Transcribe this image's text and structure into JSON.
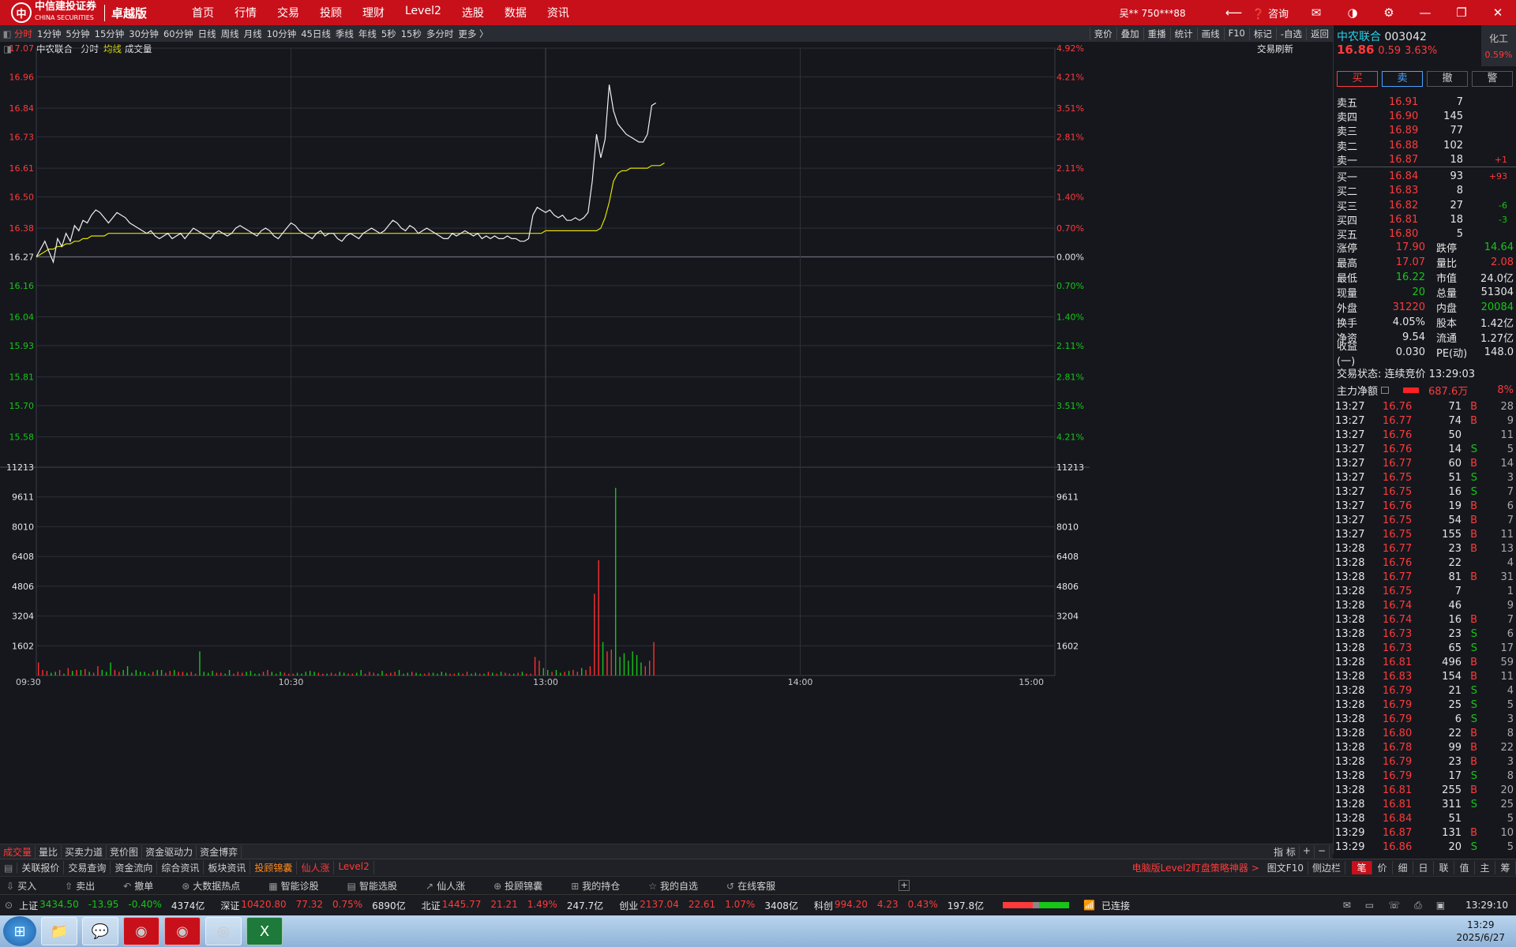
{
  "topbar": {
    "logo_name": "中信建投证券",
    "logo_sub": "CHINA SECURITIES",
    "edition": "卓越版",
    "nav": [
      "首页",
      "行情",
      "交易",
      "投顾",
      "理财",
      "Level2",
      "选股",
      "数据",
      "资讯"
    ],
    "user": "吴** 750***88",
    "consult": "咨询"
  },
  "toolbar": {
    "periods": [
      "分时",
      "1分钟",
      "5分钟",
      "15分钟",
      "30分钟",
      "60分钟",
      "日线",
      "周线",
      "月线",
      "10分钟",
      "45日线",
      "季线",
      "年线",
      "5秒",
      "15秒",
      "多分时",
      "更多 〉"
    ],
    "active": "分时",
    "right": [
      "竞价",
      "叠加",
      "重播",
      "统计",
      "画线",
      "F10",
      "标记",
      "-自选",
      "返回"
    ]
  },
  "chart_info": {
    "stock": "中农联合",
    "mode": "分时",
    "avg": "均线",
    "vol": "成交量",
    "refresh": "交易刷新"
  },
  "chart_data": {
    "type": "line",
    "prev_close": 16.27,
    "y_labels_left": [
      "17.07",
      "16.96",
      "16.84",
      "16.73",
      "16.61",
      "16.50",
      "16.38",
      "16.27",
      "16.16",
      "16.04",
      "15.93",
      "15.81",
      "15.70",
      "15.58"
    ],
    "y_labels_right": [
      "4.92%",
      "4.21%",
      "3.51%",
      "2.81%",
      "2.11%",
      "1.40%",
      "0.70%",
      "0.00%",
      "0.70%",
      "1.40%",
      "2.11%",
      "2.81%",
      "3.51%",
      "4.21%"
    ],
    "ylim": [
      15.47,
      17.07
    ],
    "vol_labels": [
      "11213",
      "9611",
      "8010",
      "6408",
      "4806",
      "3204",
      "1602"
    ],
    "vol_max": 11213,
    "x_labels": [
      "09:30",
      "10:30",
      "13:00",
      "14:00",
      "15:00"
    ],
    "total_minutes": 240,
    "price": [
      16.27,
      16.3,
      16.33,
      16.29,
      16.25,
      16.34,
      16.31,
      16.36,
      16.33,
      16.39,
      16.37,
      16.41,
      16.4,
      16.43,
      16.45,
      16.44,
      16.42,
      16.4,
      16.42,
      16.44,
      16.43,
      16.42,
      16.4,
      16.39,
      16.38,
      16.37,
      16.36,
      16.37,
      16.35,
      16.34,
      16.35,
      16.36,
      16.34,
      16.35,
      16.36,
      16.34,
      16.36,
      16.38,
      16.37,
      16.36,
      16.35,
      16.34,
      16.36,
      16.37,
      16.36,
      16.35,
      16.36,
      16.38,
      16.39,
      16.38,
      16.37,
      16.36,
      16.35,
      16.37,
      16.38,
      16.37,
      16.35,
      16.34,
      16.36,
      16.38,
      16.4,
      16.39,
      16.37,
      16.36,
      16.35,
      16.34,
      16.36,
      16.37,
      16.35,
      16.36,
      16.36,
      16.34,
      16.33,
      16.35,
      16.36,
      16.35,
      16.34,
      16.36,
      16.37,
      16.38,
      16.37,
      16.36,
      16.37,
      16.39,
      16.41,
      16.4,
      16.38,
      16.37,
      16.39,
      16.38,
      16.36,
      16.37,
      16.38,
      16.37,
      16.36,
      16.35,
      16.34,
      16.34,
      16.36,
      16.35,
      16.36,
      16.37,
      16.36,
      16.35,
      16.36,
      16.34,
      16.35,
      16.34,
      16.35,
      16.34,
      16.34,
      16.35,
      16.34,
      16.34,
      16.33,
      16.33,
      16.34,
      16.43,
      16.46,
      16.45,
      16.44,
      16.45,
      16.43,
      16.42,
      16.43,
      16.41,
      16.41,
      16.42,
      16.41,
      16.42,
      16.44,
      16.56,
      16.74,
      16.65,
      16.72,
      16.93,
      16.83,
      16.78,
      16.76,
      16.74,
      16.73,
      16.72,
      16.71,
      16.71,
      16.74,
      16.85,
      16.86
    ],
    "avg": [
      16.27,
      16.28,
      16.29,
      16.3,
      16.3,
      16.31,
      16.31,
      16.32,
      16.32,
      16.33,
      16.33,
      16.34,
      16.34,
      16.35,
      16.35,
      16.35,
      16.35,
      16.36,
      16.36,
      16.36,
      16.36,
      16.36,
      16.36,
      16.36,
      16.36,
      16.36,
      16.36,
      16.36,
      16.36,
      16.36,
      16.36,
      16.36,
      16.36,
      16.36,
      16.36,
      16.36,
      16.36,
      16.36,
      16.36,
      16.36,
      16.36,
      16.36,
      16.36,
      16.36,
      16.36,
      16.36,
      16.36,
      16.36,
      16.36,
      16.36,
      16.36,
      16.36,
      16.36,
      16.36,
      16.36,
      16.36,
      16.36,
      16.36,
      16.36,
      16.36,
      16.36,
      16.36,
      16.36,
      16.36,
      16.36,
      16.36,
      16.36,
      16.36,
      16.36,
      16.36,
      16.36,
      16.36,
      16.36,
      16.36,
      16.36,
      16.36,
      16.36,
      16.36,
      16.36,
      16.36,
      16.36,
      16.36,
      16.36,
      16.36,
      16.36,
      16.36,
      16.36,
      16.36,
      16.36,
      16.36,
      16.36,
      16.36,
      16.36,
      16.36,
      16.36,
      16.36,
      16.36,
      16.36,
      16.36,
      16.36,
      16.36,
      16.36,
      16.36,
      16.36,
      16.36,
      16.36,
      16.36,
      16.36,
      16.36,
      16.36,
      16.36,
      16.36,
      16.36,
      16.36,
      16.36,
      16.36,
      16.36,
      16.36,
      16.36,
      16.36,
      16.37,
      16.37,
      16.37,
      16.37,
      16.37,
      16.37,
      16.37,
      16.37,
      16.37,
      16.37,
      16.37,
      16.37,
      16.37,
      16.38,
      16.42,
      16.48,
      16.56,
      16.59,
      16.6,
      16.6,
      16.61,
      16.61,
      16.61,
      16.61,
      16.61,
      16.62,
      16.62,
      16.62,
      16.63
    ],
    "volume": [
      700,
      300,
      250,
      150,
      200,
      300,
      100,
      400,
      250,
      300,
      300,
      350,
      200,
      150,
      500,
      300,
      200,
      700,
      300,
      200,
      300,
      500,
      150,
      300,
      200,
      200,
      100,
      200,
      300,
      300,
      150,
      250,
      300,
      200,
      200,
      150,
      200,
      100,
      1300,
      200,
      150,
      250,
      150,
      150,
      100,
      300,
      100,
      200,
      150,
      200,
      250,
      100,
      100,
      200,
      300,
      200,
      100,
      200,
      150,
      100,
      100,
      150,
      100,
      200,
      250,
      200,
      150,
      100,
      100,
      150,
      100,
      200,
      150,
      100,
      100,
      150,
      300,
      100,
      200,
      150,
      100,
      250,
      100,
      150,
      200,
      300,
      100,
      150,
      200,
      150,
      100,
      100,
      150,
      150,
      100,
      200,
      150,
      100,
      100,
      150,
      100,
      200,
      100,
      150,
      100,
      100,
      200,
      150,
      100,
      200,
      150,
      100,
      100,
      150,
      200,
      100,
      100,
      1000,
      800,
      400,
      300,
      200,
      300,
      150,
      200,
      250,
      300,
      200,
      400,
      300,
      500,
      4400,
      6200,
      1800,
      1300,
      1400,
      10100,
      1000,
      1200,
      800,
      1300,
      1100,
      700,
      500,
      800,
      1800
    ]
  },
  "quote": {
    "name": "中农联合",
    "code": "003042",
    "industry": "化工",
    "ind_pct": "0.59%",
    "price": "16.86",
    "change": "0.59",
    "pct": "3.63%",
    "buttons": [
      "买",
      "卖",
      "撤",
      "警"
    ],
    "asks": [
      {
        "l": "卖五",
        "p": "16.91",
        "v": "7",
        "c": ""
      },
      {
        "l": "卖四",
        "p": "16.90",
        "v": "145",
        "c": ""
      },
      {
        "l": "卖三",
        "p": "16.89",
        "v": "77",
        "c": ""
      },
      {
        "l": "卖二",
        "p": "16.88",
        "v": "102",
        "c": ""
      },
      {
        "l": "卖一",
        "p": "16.87",
        "v": "18",
        "c": "+1"
      }
    ],
    "bids": [
      {
        "l": "买一",
        "p": "16.84",
        "v": "93",
        "c": "+93"
      },
      {
        "l": "买二",
        "p": "16.83",
        "v": "8",
        "c": ""
      },
      {
        "l": "买三",
        "p": "16.82",
        "v": "27",
        "c": "-6"
      },
      {
        "l": "买四",
        "p": "16.81",
        "v": "18",
        "c": "-3"
      },
      {
        "l": "买五",
        "p": "16.80",
        "v": "5",
        "c": ""
      }
    ],
    "stats": [
      [
        "涨停",
        "17.90",
        "跌停",
        "14.64"
      ],
      [
        "最高",
        "17.07",
        "量比",
        "2.08"
      ],
      [
        "最低",
        "16.22",
        "市值",
        "24.0亿"
      ],
      [
        "现量",
        "20",
        "总量",
        "51304"
      ],
      [
        "外盘",
        "31220",
        "内盘",
        "20084"
      ],
      [
        "换手",
        "4.05%",
        "股本",
        "1.42亿"
      ],
      [
        "净资",
        "9.54",
        "流通",
        "1.27亿"
      ],
      [
        "收益(一)",
        "0.030",
        "PE(动)",
        "148.0"
      ]
    ],
    "status": "交易状态: 连续竞价 13:29:03",
    "main_flow_label": "主力净额",
    "main_flow": "687.6万",
    "main_flow_pct": "8%"
  },
  "ticks": [
    [
      "13:27",
      "16.76",
      "71",
      "B",
      "28"
    ],
    [
      "13:27",
      "16.77",
      "74",
      "B",
      "9"
    ],
    [
      "13:27",
      "16.76",
      "50",
      "",
      "11"
    ],
    [
      "13:27",
      "16.76",
      "14",
      "S",
      "5"
    ],
    [
      "13:27",
      "16.77",
      "60",
      "B",
      "14"
    ],
    [
      "13:27",
      "16.75",
      "51",
      "S",
      "3"
    ],
    [
      "13:27",
      "16.75",
      "16",
      "S",
      "7"
    ],
    [
      "13:27",
      "16.76",
      "19",
      "B",
      "6"
    ],
    [
      "13:27",
      "16.75",
      "54",
      "B",
      "7"
    ],
    [
      "13:27",
      "16.75",
      "155",
      "B",
      "11"
    ],
    [
      "13:28",
      "16.77",
      "23",
      "B",
      "13"
    ],
    [
      "13:28",
      "16.76",
      "22",
      "",
      "4"
    ],
    [
      "13:28",
      "16.77",
      "81",
      "B",
      "31"
    ],
    [
      "13:28",
      "16.75",
      "7",
      "",
      "1"
    ],
    [
      "13:28",
      "16.74",
      "46",
      "",
      "9"
    ],
    [
      "13:28",
      "16.74",
      "16",
      "B",
      "7"
    ],
    [
      "13:28",
      "16.73",
      "23",
      "S",
      "6"
    ],
    [
      "13:28",
      "16.73",
      "65",
      "S",
      "17"
    ],
    [
      "13:28",
      "16.81",
      "496",
      "B",
      "59"
    ],
    [
      "13:28",
      "16.83",
      "154",
      "B",
      "11"
    ],
    [
      "13:28",
      "16.79",
      "21",
      "S",
      "4"
    ],
    [
      "13:28",
      "16.79",
      "25",
      "S",
      "5"
    ],
    [
      "13:28",
      "16.79",
      "6",
      "S",
      "3"
    ],
    [
      "13:28",
      "16.80",
      "22",
      "B",
      "8"
    ],
    [
      "13:28",
      "16.78",
      "99",
      "B",
      "22"
    ],
    [
      "13:28",
      "16.79",
      "23",
      "B",
      "3"
    ],
    [
      "13:28",
      "16.79",
      "17",
      "S",
      "8"
    ],
    [
      "13:28",
      "16.81",
      "255",
      "B",
      "20"
    ],
    [
      "13:28",
      "16.81",
      "311",
      "S",
      "25"
    ],
    [
      "13:28",
      "16.84",
      "51",
      "",
      "5"
    ],
    [
      "13:29",
      "16.87",
      "131",
      "B",
      "10"
    ],
    [
      "13:29",
      "16.86",
      "20",
      "S",
      "5"
    ]
  ],
  "bottom_tabs": [
    "成交量",
    "量比",
    "买卖力道",
    "竞价图",
    "资金驱动力",
    "资金博弈"
  ],
  "bottom_tab_right": [
    "指 标",
    "+",
    "−"
  ],
  "panel_tabs": [
    "关联报价",
    "交易查询",
    "资金流向",
    "综合资讯",
    "板块资讯",
    "投顾锦囊",
    "仙人涨",
    "Level2"
  ],
  "panel_promo": "电脑版Level2盯盘策略神器 >",
  "panel_more": [
    "图文F10",
    "侧边栏"
  ],
  "right_tabs": [
    "笔",
    "价",
    "细",
    "日",
    "联",
    "值",
    "主",
    "筹"
  ],
  "quickbar": [
    "买入",
    "卖出",
    "撤单",
    "大数据热点",
    "智能诊股",
    "智能选股",
    "仙人涨",
    "投顾锦囊",
    "我的持仓",
    "我的自选",
    "在线客服"
  ],
  "indexbar": {
    "sh": [
      "上证",
      "3434.50",
      "-13.95",
      "-0.40%",
      "4374亿"
    ],
    "sz": [
      "深证",
      "10420.80",
      "77.32",
      "0.75%",
      "6890亿"
    ],
    "bz": [
      "北证",
      "1445.77",
      "21.21",
      "1.49%",
      "247.7亿"
    ],
    "cy": [
      "创业",
      "2137.04",
      "22.61",
      "1.07%",
      "3408亿"
    ],
    "kc": [
      "科创",
      "994.20",
      "4.23",
      "0.43%",
      "197.8亿"
    ],
    "conn": "已连接",
    "time": "13:29:10"
  },
  "taskbar": {
    "time": "13:29",
    "date": "2025/6/27"
  }
}
